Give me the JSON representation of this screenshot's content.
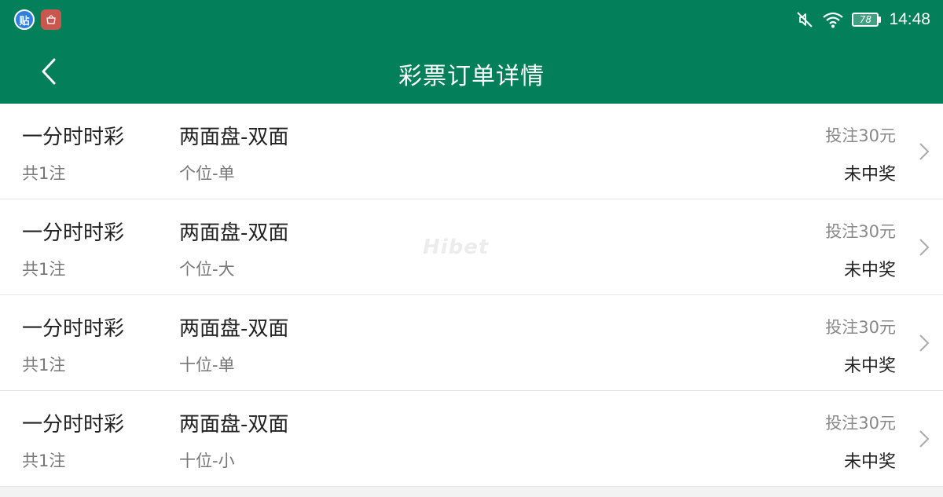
{
  "status_bar": {
    "app_icon_1": "贴",
    "battery": "78",
    "time": "14:48"
  },
  "header": {
    "title": "彩票订单详情"
  },
  "orders": [
    {
      "lottery": "一分时时彩",
      "count": "共1注",
      "play_type": "两面盘-双面",
      "detail": "个位-单",
      "amount": "投注30元",
      "status": "未中奖"
    },
    {
      "lottery": "一分时时彩",
      "count": "共1注",
      "play_type": "两面盘-双面",
      "detail": "个位-大",
      "amount": "投注30元",
      "status": "未中奖"
    },
    {
      "lottery": "一分时时彩",
      "count": "共1注",
      "play_type": "两面盘-双面",
      "detail": "十位-单",
      "amount": "投注30元",
      "status": "未中奖"
    },
    {
      "lottery": "一分时时彩",
      "count": "共1注",
      "play_type": "两面盘-双面",
      "detail": "十位-小",
      "amount": "投注30元",
      "status": "未中奖"
    }
  ],
  "watermark": "Hibet",
  "colors": {
    "primary_green": "#038059",
    "text_dark": "#222222",
    "text_gray": "#777777"
  }
}
